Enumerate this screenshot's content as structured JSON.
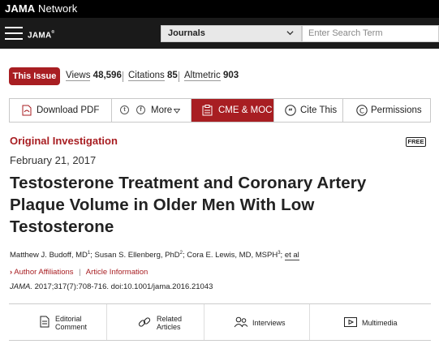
{
  "network": {
    "brand_bold": "JAMA",
    "brand_rest": " Network"
  },
  "journal_bar": {
    "logo": "JAMA",
    "journals_select": "Journals",
    "search_placeholder": "Enter Search Term"
  },
  "metrics": {
    "this_issue": "This Issue",
    "views_label": "Views",
    "views_value": "48,596",
    "citations_label": "Citations",
    "citations_value": "85",
    "altmetric_label": "Altmetric",
    "altmetric_value": "903"
  },
  "toolbar": {
    "download_pdf": "Download PDF",
    "more": "More",
    "cme_moc": "CME & MOC",
    "cite_this": "Cite This",
    "permissions": "Permissions"
  },
  "article": {
    "type": "Original Investigation",
    "free_badge": "FREE",
    "date": "February 21, 2017",
    "title": "Testosterone Treatment and Coronary Artery Plaque Volume in Older Men With Low Testosterone",
    "author1": "Matthew J. Budoff, MD",
    "author2": "Susan S. Ellenberg, PhD",
    "author3": "Cora E. Lewis, MD, MSPH",
    "et_al": "et al",
    "author_affiliations": "Author Affiliations",
    "article_information": "Article Information",
    "citation_journal": "JAMA.",
    "citation_rest": " 2017;317(7):708-716. doi:10.1001/jama.2016.21043"
  },
  "related": {
    "editorial_line1": "Editorial",
    "editorial_line2": "Comment",
    "related_line1": "Related",
    "related_line2": "Articles",
    "interviews": "Interviews",
    "multimedia": "Multimedia"
  },
  "colors": {
    "brand_red": "#a81e22",
    "bar_black": "#000000",
    "bar_dark": "#1a1a1a"
  }
}
